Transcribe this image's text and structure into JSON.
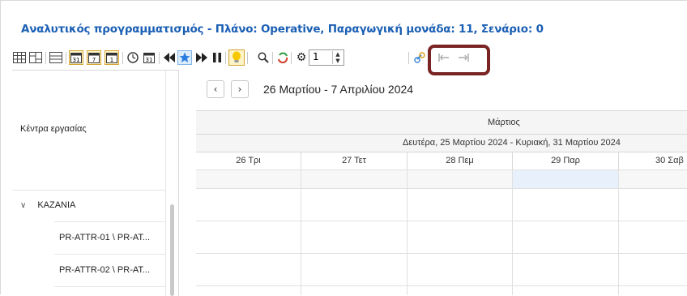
{
  "window": {
    "title": "Αναλυτικός προγραμματισμός - Πλάνο: Operative, Παραγωγική μονάδα: 11, Σενάριο: 0"
  },
  "toolbar": {
    "spinner_value": "1",
    "icons": [
      "grid-view-icon",
      "split-view-icon",
      "list-view-icon",
      "calendar-31-icon",
      "calendar-7-icon",
      "calendar-1-icon",
      "clock-icon",
      "calendar-today-icon",
      "rewind-icon",
      "favorite-star-icon",
      "fast-forward-icon",
      "pause-icon",
      "lightbulb-icon",
      "zoom-icon",
      "refresh-icon",
      "settings-gear-icon",
      "link-icon",
      "undo-indent-icon",
      "redo-indent-icon"
    ],
    "highlight_color": "#7a2323",
    "accent": "#1a5fb4"
  },
  "left_panel": {
    "header_label": "Κέντρα εργασίας",
    "group_label": "ΚΑΖΑΝΙΑ",
    "resources": [
      "PR-ATTR-01 \\ PR-AT...",
      "PR-ATTR-02 \\ PR-AT..."
    ]
  },
  "scheduler": {
    "prev_label": "‹",
    "next_label": "›",
    "date_range": "26 Μαρτίου - 7 Απριλίου 2024",
    "month_label": "Μάρτιος",
    "week_label": "Δευτέρα, 25 Μαρτίου 2024 - Κυριακή, 31 Μαρτίου 2024",
    "days": [
      "26 Τρι",
      "27 Τετ",
      "28 Πεμ",
      "29 Παρ",
      "30 Σαβ"
    ],
    "today_color": "#e8f1fb"
  }
}
